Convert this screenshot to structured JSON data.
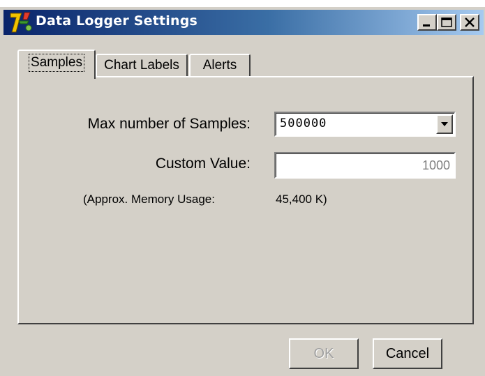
{
  "window": {
    "title": "Data Logger Settings",
    "icon": "app-logo-icon",
    "controls": [
      "minimize-icon",
      "maximize-icon",
      "close-icon"
    ]
  },
  "tabs": [
    {
      "label": "Samples",
      "active": true
    },
    {
      "label": "Chart Labels",
      "active": false
    },
    {
      "label": "Alerts",
      "active": false
    }
  ],
  "samples": {
    "max_label": "Max number of Samples:",
    "max_value": "500000",
    "custom_label": "Custom Value:",
    "custom_value": "1000",
    "memory_label": "(Approx. Memory Usage:",
    "memory_value": "45,400 K)"
  },
  "buttons": {
    "ok": "OK",
    "cancel": "Cancel"
  },
  "colors": {
    "titlebar_start": "#0a246a",
    "titlebar_end": "#a6caf0",
    "face": "#d4d0c8",
    "disabled_text": "#a0a0a0"
  }
}
